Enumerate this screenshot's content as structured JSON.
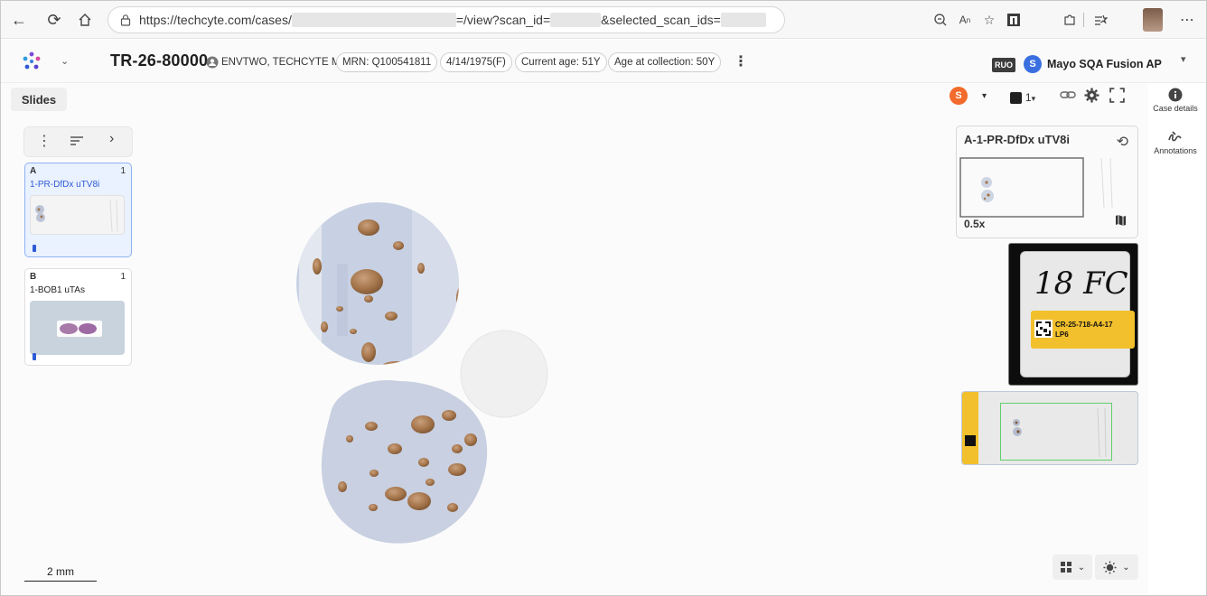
{
  "browser": {
    "url_prefix": "https://techcyte.com/cases/",
    "url_mid": "=/view?scan_id=",
    "url_mid2": "&selected_scan_ids="
  },
  "header": {
    "case_id": "TR-26-80000",
    "patient": "ENVTWO, TECHCYTE M",
    "mrn": "MRN: Q100541811",
    "dob": "4/14/1975(F)",
    "current_age": "Current age: 51Y",
    "age_at_collection": "Age at collection: 50Y",
    "ruo_badge": "RUO",
    "org_avatar": "S",
    "org_name": "Mayo SQA Fusion AP"
  },
  "toolbar": {
    "slides_tab": "Slides",
    "user_avatar": "S",
    "layer_count": "1"
  },
  "side_actions": {
    "case_details": "Case details",
    "annotations": "Annotations"
  },
  "slides": [
    {
      "group": "A",
      "count": "1",
      "label": "1-PR-DfDx uTV8i",
      "selected": true
    },
    {
      "group": "B",
      "count": "1",
      "label": "1-BOB1 uTAs",
      "selected": false
    }
  ],
  "overview": {
    "name": "A-1-PR-DfDx uTV8i",
    "zoom": "0.5x"
  },
  "label_image": {
    "handwriting": "18 FC",
    "barcode_text_1": "CR-25-718-A4-17",
    "barcode_text_2": "LP6"
  },
  "scale_bar": "2 mm",
  "colors": {
    "accent": "#2f5bd6",
    "user_avatar": "#f26b2c",
    "org_avatar": "#3a6fe0",
    "stain": "#a5754b",
    "tissue": "#c8d2e4"
  }
}
